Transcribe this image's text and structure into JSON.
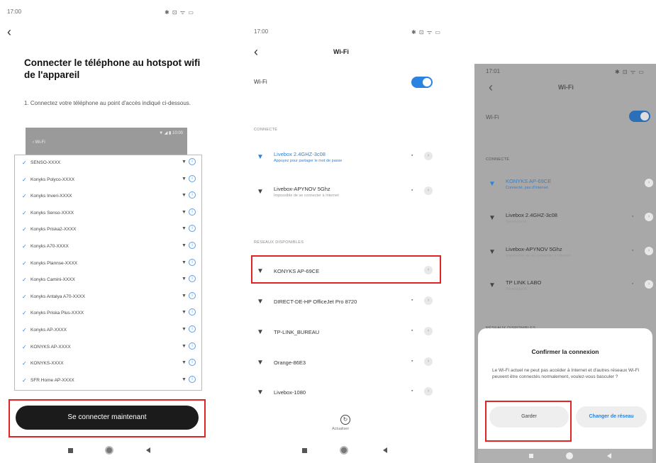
{
  "panel1": {
    "time": "17:00",
    "status_icons": "✱ ⊡ ᯤ ▭",
    "back_icon": "‹",
    "title": "Connecter le téléphone au hotspot wifi de l'appareil",
    "instruction": "1. Connectez votre téléphone au point d'accès indiqué ci-dessous.",
    "preview_status": "▼ ◢ ▮ 10:00",
    "preview_label": "‹  Wi-Fi",
    "networks": [
      "SENSO-XXXX",
      "Konyks Polyco-XXXX",
      "Konyks Inveri-XXXX",
      "Konyks Senso-XXXX",
      "Konyks Priska2-XXXX",
      "Konyks A70-XXXX",
      "Konyks Plannse-XXXX",
      "Konyks Camini-XXXX",
      "Konyks Antalya A70-XXXX",
      "Konyks Priska Plus-XXXX",
      "Konyks AP-XXXX",
      "KONYKS AP-XXXX",
      "KONYKS-XXXX",
      "SFR Home AP-XXXX"
    ],
    "connect_button": "Se connecter maintenant"
  },
  "panel2": {
    "time": "17:00",
    "status_icons": "✱ ⊡ ᯤ ▭",
    "back_icon": "‹",
    "header": "Wi-Fi",
    "wifi_label": "Wi-Fi",
    "section_connected": "CONNECTÉ",
    "connected": [
      {
        "name": "Livebox 2.4GHZ-3c08",
        "sub": "Appuyez pour partager le mot de passe",
        "blue": true
      },
      {
        "name": "Livebox-APYNOV 5Ghz",
        "sub": "Impossible de se connecter à Internet",
        "blue": false
      }
    ],
    "section_available": "RÉSEAUX DISPONIBLES",
    "available": [
      "KONYKS AP-69CE",
      "DIRECT-DE-HP OfficeJet Pro 8720",
      "TP-LINK_BUREAU",
      "Orange-86E3",
      "Livebox-1080"
    ],
    "refresh_label": "Actualiser"
  },
  "panel3": {
    "time": "17:01",
    "status_icons": "✱ ⊡ ᯤ ▭",
    "back_icon": "‹",
    "header": "Wi-Fi",
    "wifi_label": "Wi-Fi",
    "section_connected": "CONNECTÉ",
    "networks": [
      {
        "name": "KONYKS AP-69CE",
        "sub": "Connecté, pas d'Internet",
        "blue": true
      },
      {
        "name": "Livebox 2.4GHZ-3c08",
        "sub": "Sauvegardé",
        "blue": false
      },
      {
        "name": "Livebox-APYNOV 5Ghz",
        "sub": "Impossible de se connecter à Internet",
        "blue": false
      },
      {
        "name": "TP LINK LABO",
        "sub": "Sauvegardé",
        "blue": false
      }
    ],
    "section_available": "RÉSEAUX DISPONIBLES",
    "dialog": {
      "title": "Confirmer la connexion",
      "body": "Le Wi-Fi actuel ne peut pas accéder à Internet et d'autres réseaux Wi-Fi peuvent être connectés normalement, voulez-vous basculer ?",
      "keep_button": "Garder",
      "change_button": "Changer de réseau"
    }
  },
  "icons": {
    "wifi": "wifi-icon",
    "lock": "lock-icon",
    "check": "check-icon",
    "info": "info-icon",
    "chevron": "chevron-right-icon"
  },
  "colors": {
    "accent": "#2a83e0",
    "highlight": "#e02424"
  }
}
